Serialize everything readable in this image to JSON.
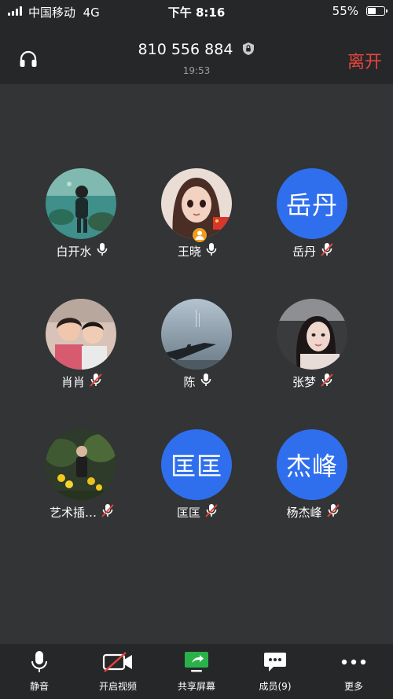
{
  "status_bar": {
    "carrier": "中国移动",
    "network": "4G",
    "time": "下午 8:16",
    "battery": "55%",
    "battery_level": 0.55
  },
  "header": {
    "meeting_id": "810 556 884",
    "elapsed": "19:53",
    "leave_label": "离开"
  },
  "participants": [
    {
      "name": "白开水",
      "mic": "on",
      "avatar": "photo-diver"
    },
    {
      "name": "王晓",
      "mic": "on",
      "avatar": "photo-cartoon-girl",
      "host": true
    },
    {
      "name": "岳丹",
      "mic": "muted",
      "avatar_text": "岳丹"
    },
    {
      "name": "肖肖",
      "mic": "muted",
      "avatar": "photo-mother-child"
    },
    {
      "name": "陈",
      "mic": "on",
      "avatar": "photo-airplane-wing"
    },
    {
      "name": "张梦",
      "mic": "muted",
      "avatar": "photo-woman-portrait"
    },
    {
      "name": "艺术插…",
      "mic": "muted",
      "avatar": "photo-garden-flowers"
    },
    {
      "name": "匡匡",
      "mic": "muted",
      "avatar_text": "匡匡"
    },
    {
      "name": "杨杰峰",
      "mic": "muted",
      "avatar_text": "杰峰"
    }
  ],
  "toolbar": [
    {
      "label": "静音",
      "icon": "microphone-icon"
    },
    {
      "label": "开启视频",
      "icon": "video-off-icon"
    },
    {
      "label": "共享屏幕",
      "icon": "share-screen-icon"
    },
    {
      "label": "成员(9)",
      "icon": "members-chat-icon"
    },
    {
      "label": "更多",
      "icon": "more-dots-icon"
    }
  ],
  "colors": {
    "accent_blue": "#2f6fed",
    "leave_red": "#e6453d",
    "share_green": "#2bb14a",
    "mute_red": "#e6453d"
  }
}
